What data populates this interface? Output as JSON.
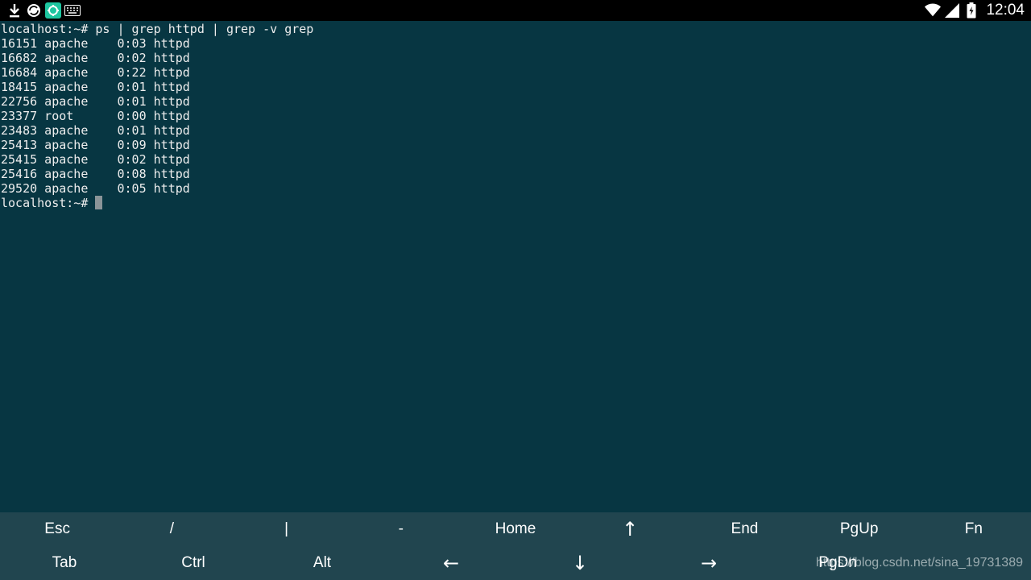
{
  "status_bar": {
    "time": "12:04",
    "left_icons": [
      "download-icon",
      "sync-icon",
      "app-icon",
      "keyboard-icon"
    ],
    "right_icons": [
      "wifi-icon",
      "signal-icon",
      "battery-icon"
    ]
  },
  "terminal": {
    "lines": [
      "localhost:~# ps | grep httpd | grep -v grep",
      "16151 apache    0:03 httpd",
      "16682 apache    0:02 httpd",
      "16684 apache    0:22 httpd",
      "18415 apache    0:01 httpd",
      "22756 apache    0:01 httpd",
      "23377 root      0:00 httpd",
      "23483 apache    0:01 httpd",
      "25413 apache    0:09 httpd",
      "25415 apache    0:02 httpd",
      "25416 apache    0:08 httpd",
      "29520 apache    0:05 httpd"
    ],
    "prompt": "localhost:~# "
  },
  "extra_keys": {
    "row1": [
      "Esc",
      "/",
      "|",
      "-",
      "Home",
      "↑",
      "End",
      "PgUp",
      "Fn"
    ],
    "row2": [
      "Tab",
      "Ctrl",
      "Alt",
      "←",
      "↓",
      "→",
      "PgDn"
    ]
  },
  "watermark": "https://blog.csdn.net/sina_19731389",
  "colors": {
    "terminal_bg": "#073642",
    "keybar_bg": "#21454f",
    "statusbar_bg": "#000000"
  }
}
